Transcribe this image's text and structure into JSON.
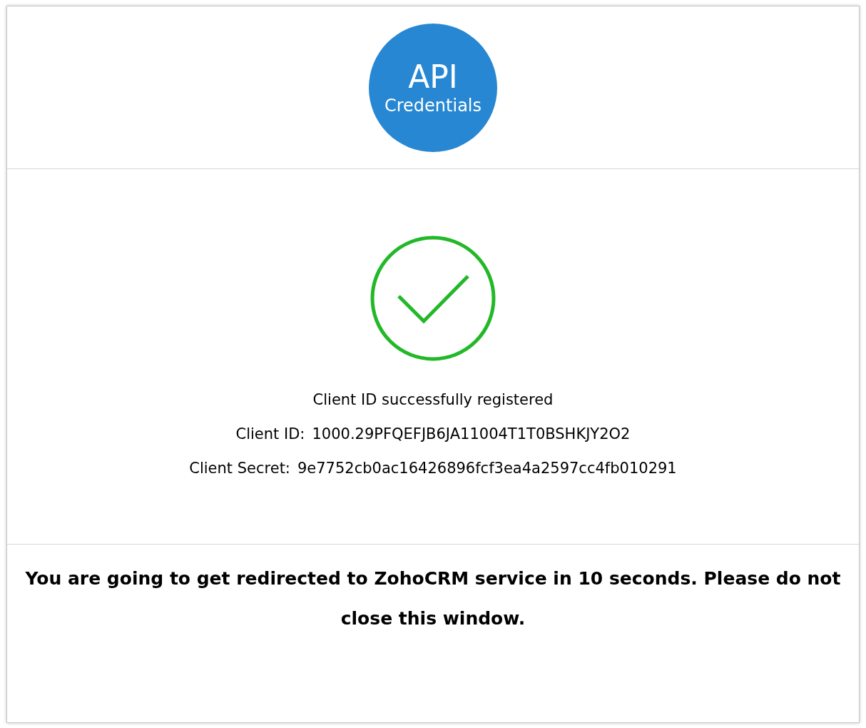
{
  "logo": {
    "line_1": "API",
    "line_2": "Credentials"
  },
  "status": {
    "message": "Client ID successfully registered",
    "fields": [
      {
        "label": "Client ID:",
        "value": "1000.29PFQEFJB6JA11004T1T0BSHKJY2O2"
      },
      {
        "label": "Client Secret:",
        "value": "9e7752cb0ac16426896fcf3ea4a2597cc4fb010291"
      }
    ]
  },
  "notice": "You are going to get redirected to ZohoCRM service in 10 seconds. Please do not close this window."
}
